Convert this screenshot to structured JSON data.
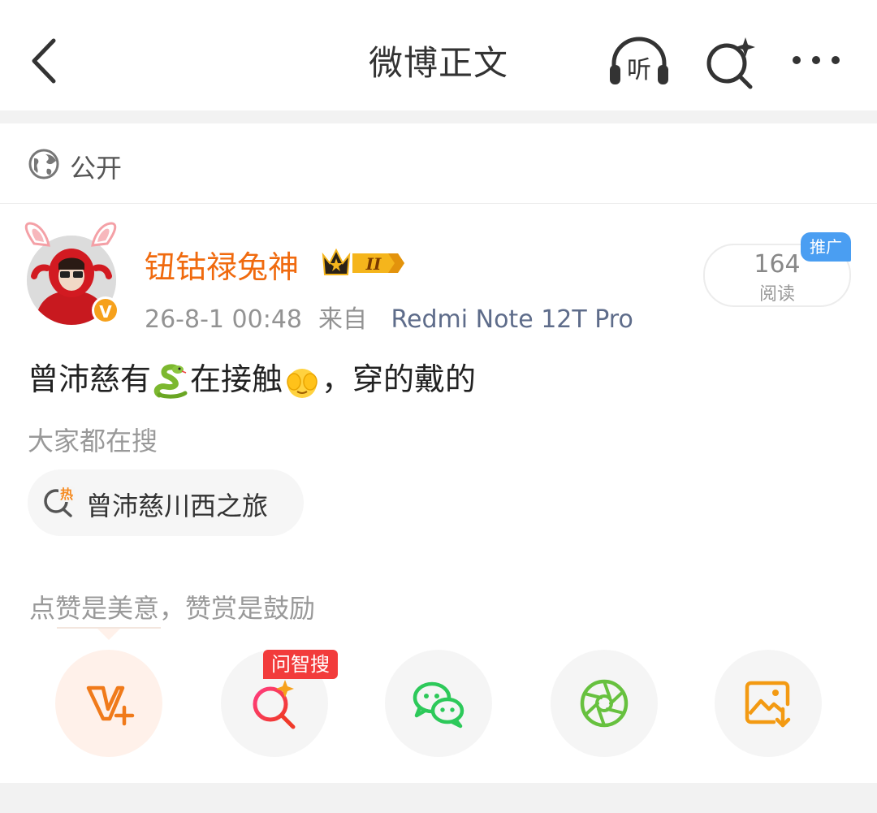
{
  "nav": {
    "title": "微博正文",
    "listen_label": "听"
  },
  "post": {
    "visibility": "公开",
    "author": {
      "name": "钮钴禄兔神",
      "member_level": "II",
      "verified_mark": "V"
    },
    "time": "26-8-1 00:48",
    "source_prefix": "来自",
    "source_device": "Redmi Note 12T Pro",
    "reads": {
      "count": "164",
      "label": "阅读",
      "promo": "推广"
    },
    "text_parts": [
      "曾沛慈有",
      "在接触",
      "，穿的戴的"
    ],
    "emojis": [
      "snake-emoji",
      "covering-face-emoji"
    ]
  },
  "hot_search": {
    "header": "大家都在搜",
    "hot_icon_text": "热",
    "item": "曾沛慈川西之旅"
  },
  "share": {
    "reward_hint": "点赞是美意，赞赏是鼓励",
    "zhisou_tag": "问智搜",
    "buttons": [
      "v-plus-icon",
      "zhisou-icon",
      "wechat-icon",
      "moments-icon",
      "save-image-icon"
    ]
  },
  "colors": {
    "username": "#f06a0e",
    "device": "#5e6c8a",
    "promo": "#4a9ef2",
    "zhisou_tag": "#f23b3b",
    "wechat": "#2dc95a",
    "moments": "#67c13f",
    "vplus": "#f07a1a",
    "save_image": "#f39a12"
  }
}
